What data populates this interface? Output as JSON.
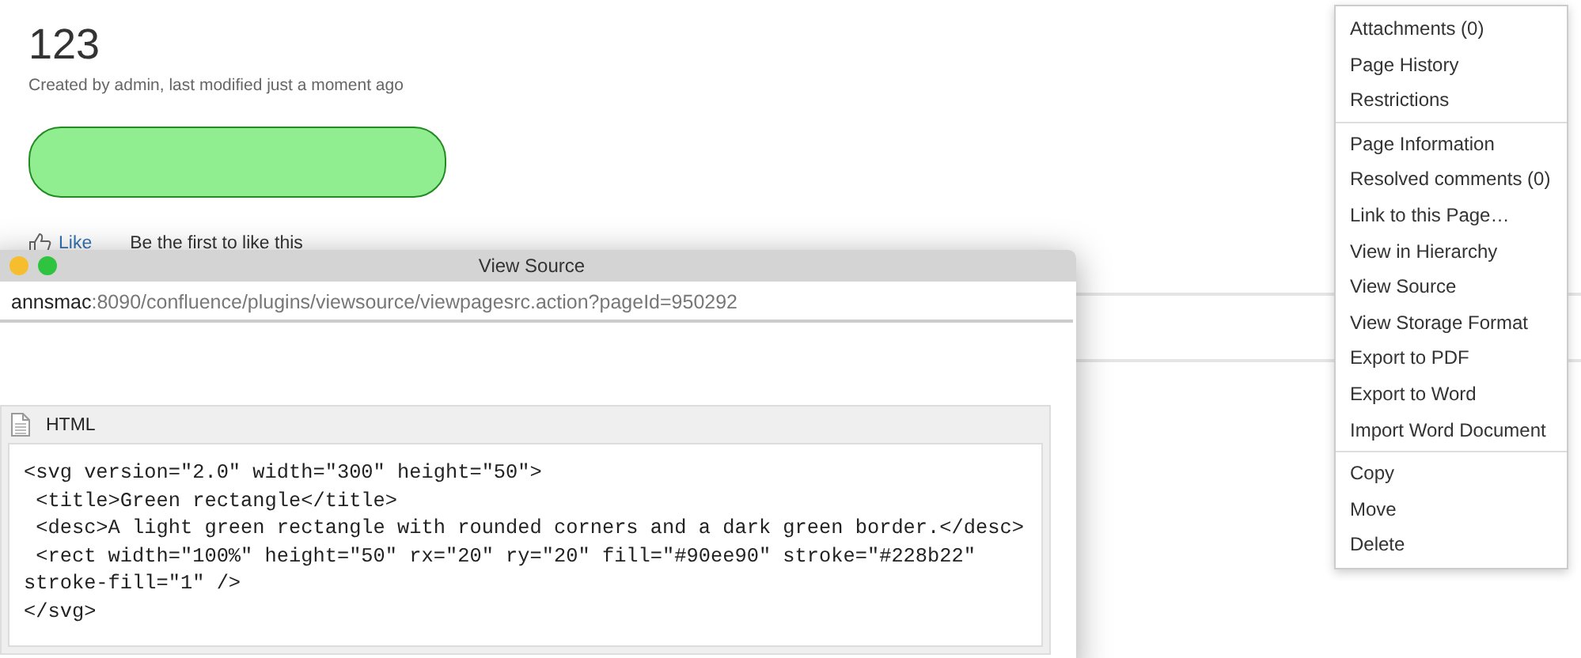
{
  "page": {
    "title": "123",
    "byline": "Created by admin, last modified just a moment ago",
    "like": {
      "label": "Like",
      "note": "Be the first to like this"
    }
  },
  "source_window": {
    "title": "View Source",
    "url_host": "annsmac",
    "url_rest": ":8090/confluence/plugins/viewsource/viewpagesrc.action?pageId=950292",
    "panel_title": "HTML",
    "code_lines": [
      "<svg version=\"2.0\" width=\"300\" height=\"50\">",
      " <title>Green rectangle</title>",
      " <desc>A light green rectangle with rounded corners and a dark green border.</desc>",
      " <rect width=\"100%\" height=\"50\" rx=\"20\" ry=\"20\" fill=\"#90ee90\" stroke=\"#228b22\"",
      "stroke-fill=\"1\" />",
      "</svg>"
    ]
  },
  "menu": {
    "groups": [
      [
        "Attachments (0)",
        "Page History",
        "Restrictions"
      ],
      [
        "Page Information",
        "Resolved comments (0)",
        "Link to this Page…",
        "View in Hierarchy",
        "View Source",
        "View Storage Format",
        "Export to PDF",
        "Export to Word",
        "Import Word Document"
      ],
      [
        "Copy",
        "Move",
        "Delete"
      ]
    ]
  }
}
